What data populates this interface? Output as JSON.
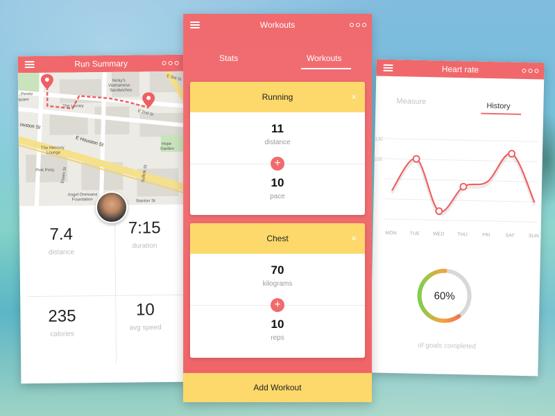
{
  "left": {
    "title": "Run Summary",
    "map_labels": {
      "peretz": "Peretz",
      "quare": "quare",
      "library": "The Library",
      "nickys": "Nicky's",
      "vietnamese": "Vietnamese",
      "sandwiches": "Sandwiches",
      "e3rd": "E 3rd St",
      "e2nd": "E 2nd St",
      "houston1": "ouston St",
      "houston2": "E Houston St",
      "mercury1": "The Mercury",
      "mercury2": "Lounge",
      "hope1": "Hope",
      "hope2": "Garden",
      "pinkpony": "Pink Pony",
      "essex": "Essex St",
      "suffolk": "Suffolk St",
      "angel1": "Angel Orensanz",
      "angel2": "Foundation",
      "stanton": "Stanton St"
    },
    "stats": [
      {
        "value": "7.4",
        "label": "distance"
      },
      {
        "value": "7:15",
        "label": "duration"
      },
      {
        "value": "235",
        "label": "calories"
      },
      {
        "value": "10",
        "label": "avg speed"
      }
    ]
  },
  "center": {
    "title": "Workouts",
    "tabs": [
      {
        "label": "Stats"
      },
      {
        "label": "Workouts"
      }
    ],
    "cards": [
      {
        "title": "Running",
        "close": "×",
        "metrics": [
          {
            "value": "11",
            "unit": "distance"
          },
          {
            "value": "10",
            "unit": "pace"
          }
        ]
      },
      {
        "title": "Chest",
        "close": "×",
        "metrics": [
          {
            "value": "70",
            "unit": "kilograms"
          },
          {
            "value": "10",
            "unit": "reps"
          }
        ]
      }
    ],
    "plus": "+",
    "add_button": "Add Workout"
  },
  "right": {
    "title": "Heart rate",
    "tabs": [
      {
        "label": "Measure"
      },
      {
        "label": "History"
      }
    ],
    "percent_text": "60%",
    "goal_fraction": 0.6,
    "goal_caption": "of goals completed"
  },
  "chart_data": {
    "type": "line",
    "x": [
      "MON",
      "TUE",
      "WED",
      "THU",
      "FRI",
      "SAT",
      "SUN"
    ],
    "series": [
      {
        "values": [
          72,
          108,
          50,
          78,
          84,
          116,
          62
        ]
      }
    ],
    "ytick_labels": [
      "130",
      "100",
      "",
      "",
      ""
    ],
    "marked_points": [
      1,
      2,
      3,
      5
    ],
    "line_color": "#ef5f62"
  },
  "colors": {
    "accent": "#f06a6e",
    "yellow": "#fcd96a",
    "donut_gray": "#d8d8d8"
  }
}
